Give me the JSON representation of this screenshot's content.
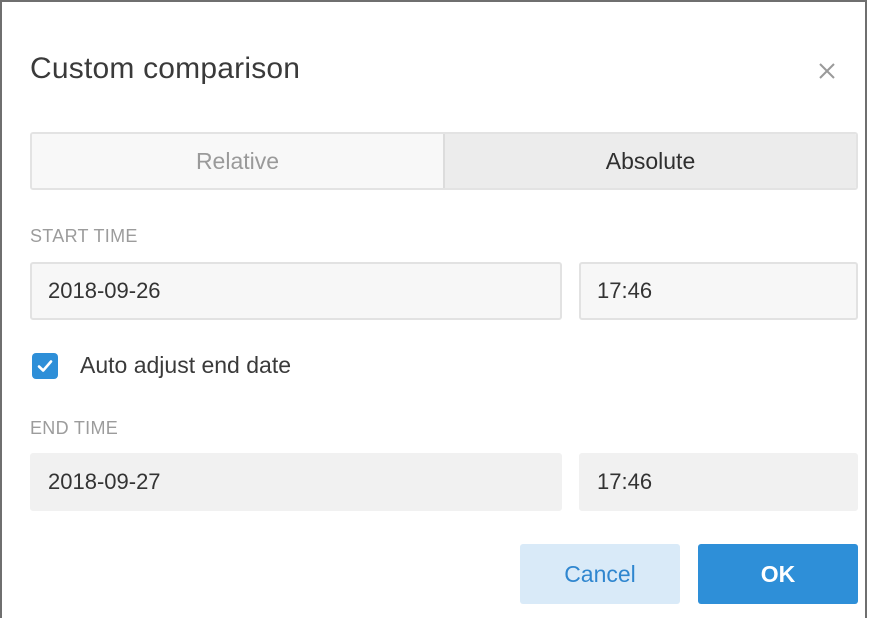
{
  "dialog": {
    "title": "Custom comparison",
    "close_icon": "close-icon"
  },
  "mode_toggle": {
    "options": [
      {
        "label": "Relative",
        "selected": false
      },
      {
        "label": "Absolute",
        "selected": true
      }
    ]
  },
  "start_time": {
    "label": "START TIME",
    "date": "2018-09-26",
    "time": "17:46"
  },
  "auto_adjust": {
    "label": "Auto adjust end date",
    "checked": true,
    "icon": "checkmark-icon"
  },
  "end_time": {
    "label": "END TIME",
    "date": "2018-09-27",
    "time": "17:46"
  },
  "actions": {
    "cancel_label": "Cancel",
    "ok_label": "OK"
  },
  "colors": {
    "accent": "#2e8fd8",
    "cancel_bg": "#d9eaf8",
    "cancel_text": "#2f86cf"
  }
}
